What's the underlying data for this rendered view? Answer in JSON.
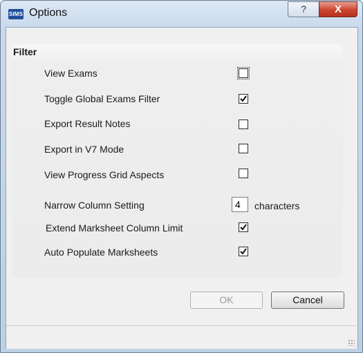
{
  "window": {
    "app_icon_text": "SIMS",
    "title": "Options",
    "help_glyph": "?",
    "close_glyph": "X"
  },
  "filter": {
    "title": "Filter",
    "options": [
      {
        "label": "View Exams",
        "checked": false
      },
      {
        "label": "Toggle Global Exams Filter",
        "checked": true
      },
      {
        "label": "Export Result Notes",
        "checked": false
      },
      {
        "label": "Export in V7 Mode",
        "checked": false
      },
      {
        "label": "View Progress Grid Aspects",
        "checked": false
      }
    ],
    "narrow_column": {
      "label": "Narrow Column Setting",
      "value": "4",
      "suffix": "characters"
    },
    "extra_options": [
      {
        "label": "Extend Marksheet Column Limit",
        "checked": true
      },
      {
        "label": "Auto Populate Marksheets",
        "checked": true
      }
    ]
  },
  "buttons": {
    "ok": "OK",
    "cancel": "Cancel"
  }
}
